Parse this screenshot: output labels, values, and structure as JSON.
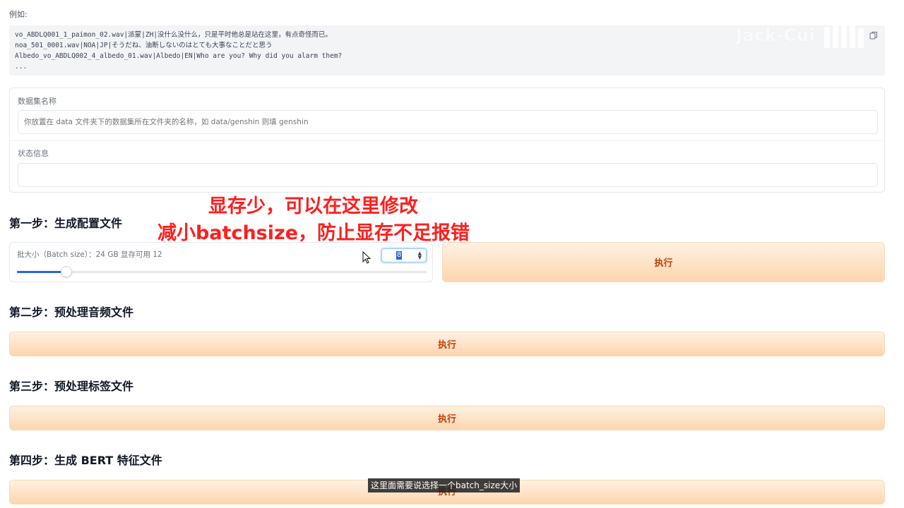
{
  "example": {
    "label": "例如:",
    "lines": [
      "vo_ABDLQ001_1_paimon_02.wav|派蒙|ZH|没什么没什么，只是平时他总是站在这里，有点奇怪而已。",
      "noa_501_0001.wav|NOA|JP|そうだね、油断しないのはとても大事なことだと思う",
      "Albedo_vo_ABDLQ002_4_albedo_01.wav|Albedo|EN|Who are you? Why did you alarm them?",
      "..."
    ]
  },
  "watermark": "Jack-Cui",
  "dataset": {
    "label": "数据集名称",
    "placeholder": "你放置在 data 文件夹下的数据集所在文件夹的名称，如 data/genshin 则填 genshin",
    "value": ""
  },
  "status": {
    "label": "状态信息",
    "value": ""
  },
  "annotation": {
    "line1": "显存少，可以在这里修改",
    "line2": "减小batchsize，防止显存不足报错"
  },
  "step1": {
    "title": "第一步：生成配置文件",
    "slider_label": "批大小（Batch size）：24 GB 显存可用 12",
    "batch_size": 8,
    "slider_fraction": 0.12,
    "button": "执行"
  },
  "step2": {
    "title": "第二步：预处理音频文件",
    "button": "执行"
  },
  "step3": {
    "title": "第三步：预处理标签文件",
    "button": "执行"
  },
  "step4": {
    "title": "第四步：生成 BERT 特征文件",
    "button": "执行"
  },
  "subtitle": "这里面需要说选择一个batch_size大小",
  "colors": {
    "accent": "#2563eb",
    "button_text": "#c2410c",
    "annotation": "#ff1f1f"
  }
}
